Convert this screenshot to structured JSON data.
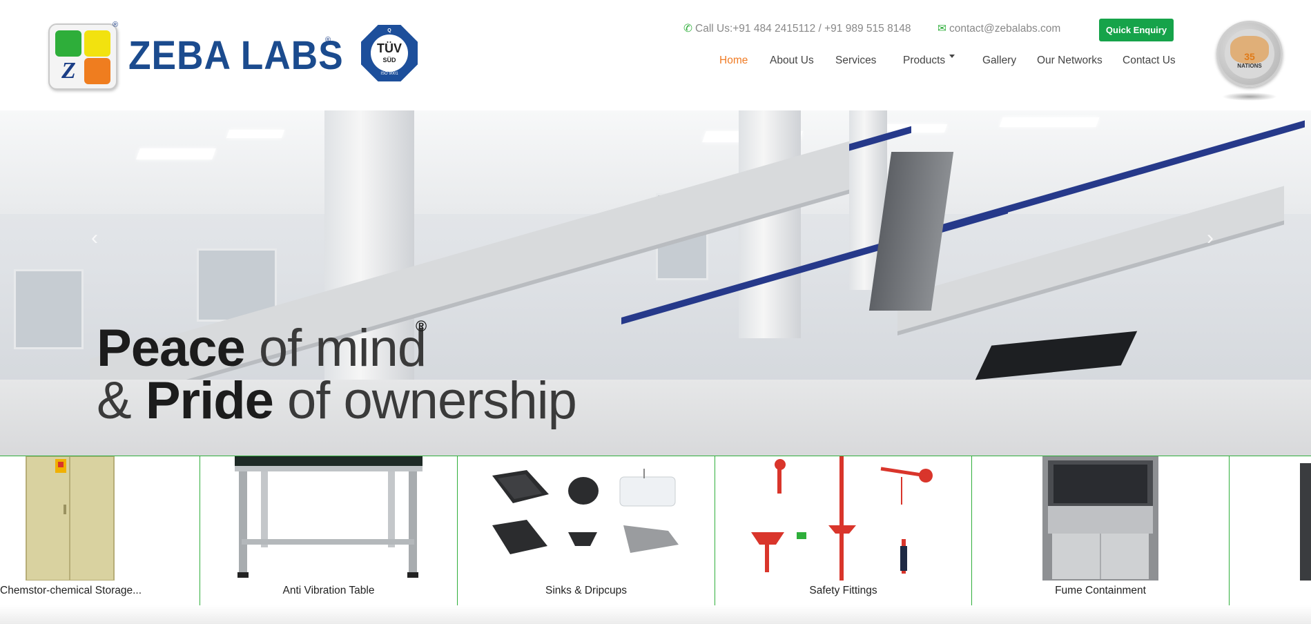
{
  "brand": {
    "logo_letter": "Z",
    "name": "ZEBA LABS",
    "registered_mark": "®",
    "cert_top": "Q",
    "cert_main": "TÜV",
    "cert_sub": "SÜD",
    "cert_bottom": "ISO 9001"
  },
  "contact": {
    "phone_icon": "phone-icon",
    "phone_text": "Call Us:+91 484 2415112 / +91 989 515 8148",
    "email_icon": "envelope-icon",
    "email_text": "contact@zebalabs.com"
  },
  "quick_enquiry_label": "Quick Enquiry",
  "nav": {
    "items": [
      "Home",
      "About Us",
      "Services",
      "Products",
      "Gallery",
      "Our Networks",
      "Contact Us"
    ],
    "active": "Home"
  },
  "badge": {
    "number": "35",
    "label": "NATIONS"
  },
  "hero": {
    "line1_bold": "Peace",
    "line1_light": " of mind",
    "reg": "®",
    "line2_amp": "&",
    "line2_bold": "Pride",
    "line2_light": " of ownership",
    "prev_icon": "chevron-left-icon",
    "next_icon": "chevron-right-icon"
  },
  "products": [
    {
      "label": "Chemstor-chemical Storage...",
      "icon": "cabinet-image"
    },
    {
      "label": "Anti Vibration Table",
      "icon": "table-image"
    },
    {
      "label": "Sinks & Dripcups",
      "icon": "sinks-image"
    },
    {
      "label": "Safety Fittings",
      "icon": "safety-fittings-image"
    },
    {
      "label": "Fume Containment",
      "icon": "fume-hood-image"
    }
  ],
  "colors": {
    "accent_green": "#16a34a",
    "nav_active": "#f07b24",
    "brand_blue": "#1b4b8e",
    "strip_border": "#2eae3a"
  }
}
